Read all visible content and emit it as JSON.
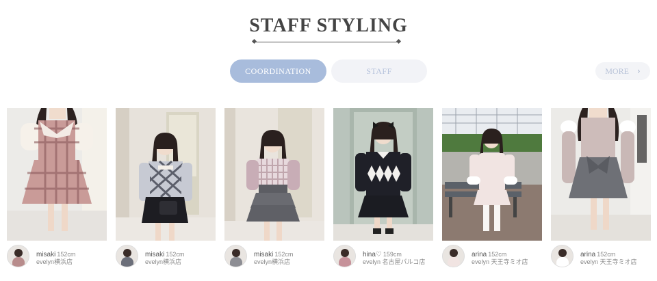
{
  "header": {
    "title": "STAFF STYLING"
  },
  "tabs": [
    {
      "label": "COORDINATION",
      "active": true
    },
    {
      "label": "STAFF",
      "active": false
    }
  ],
  "more": {
    "label": "MORE",
    "icon": "chevron-right-icon"
  },
  "colors": {
    "accent": "#a8bcdc",
    "tab_inactive": "#f2f3f7",
    "text": "#555555"
  },
  "cards": [
    {
      "name": "misaki",
      "height": "152cm",
      "shop": "evelyn横浜店"
    },
    {
      "name": "misaki",
      "height": "152cm",
      "shop": "evelyn横浜店"
    },
    {
      "name": "misaki",
      "height": "152cm",
      "shop": "evelyn横浜店"
    },
    {
      "name": "hina♡",
      "height": "159cm",
      "shop": "evelyn 名古屋パルコ店"
    },
    {
      "name": "arina",
      "height": "152cm",
      "shop": "evelyn 天王寺ミオ店"
    },
    {
      "name": "arina",
      "height": "152cm",
      "shop": "evelyn 天王寺ミオ店"
    }
  ]
}
